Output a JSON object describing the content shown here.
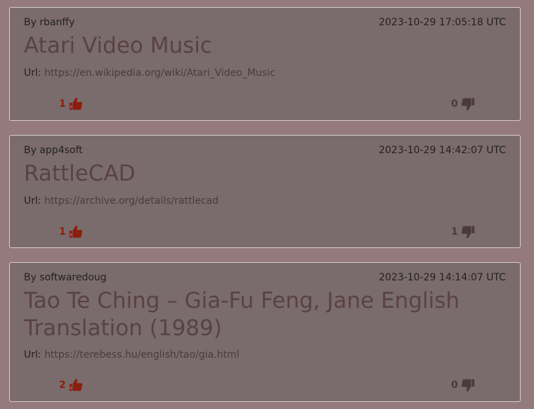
{
  "colors": {
    "background": "#947a7b",
    "card": "#7a6c6d",
    "upvote": "#8b1e0f",
    "downvote": "#4a3a3c"
  },
  "posts": [
    {
      "author": "By rbanffy",
      "date": "2023-10-29 17:05:18 UTC",
      "title": "Atari Video Music",
      "url_label": "Url:",
      "url": "https://en.wikipedia.org/wiki/Atari_Video_Music",
      "upvotes": "1",
      "downvotes": "0",
      "upvote_icon": "thumbs-up-icon",
      "downvote_icon": "thumbs-down-icon"
    },
    {
      "author": "By app4soft",
      "date": "2023-10-29 14:42:07 UTC",
      "title": "RattleCAD",
      "url_label": "Url:",
      "url": "https://archive.org/details/rattlecad",
      "upvotes": "1",
      "downvotes": "1",
      "upvote_icon": "thumbs-up-icon",
      "downvote_icon": "thumbs-down-icon"
    },
    {
      "author": "By softwaredoug",
      "date": "2023-10-29 14:14:07 UTC",
      "title": "Tao Te Ching – Gia-Fu Feng, Jane English Translation (1989)",
      "url_label": "Url:",
      "url": "https://terebess.hu/english/tao/gia.html",
      "upvotes": "2",
      "downvotes": "0",
      "upvote_icon": "thumbs-up-icon",
      "downvote_icon": "thumbs-down-icon"
    }
  ]
}
